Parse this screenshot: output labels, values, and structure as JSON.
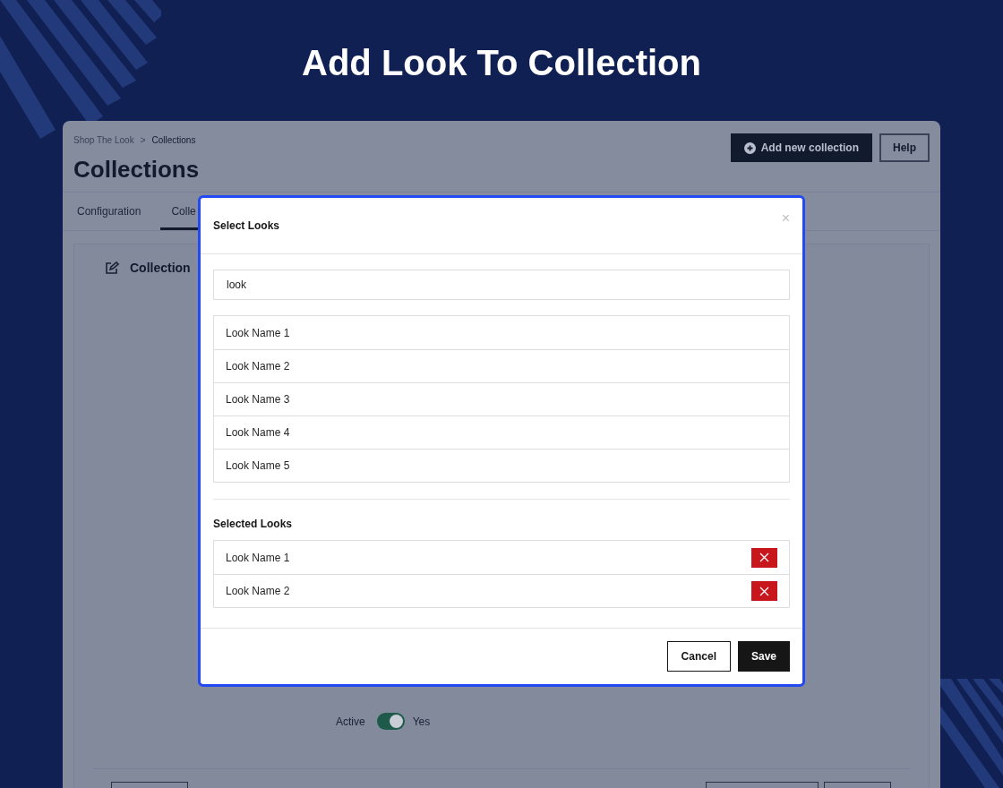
{
  "page_title": "Add Look To Collection",
  "app": {
    "breadcrumb": [
      {
        "label": "Shop The Look"
      },
      {
        "label": "Collections"
      }
    ],
    "breadcrumb_separator": ">",
    "heading": "Collections",
    "header_buttons": [
      {
        "label": "Add new collection",
        "kind": "primary"
      },
      {
        "label": "Help",
        "kind": "outline"
      }
    ],
    "tabs": [
      {
        "label": "Configuration",
        "selected": false
      },
      {
        "label": "Colle",
        "selected": true
      }
    ],
    "section_title": "Collection",
    "active_label": "Active",
    "active_toggle": {
      "on": true,
      "label": "Yes"
    }
  },
  "modal": {
    "title": "Select Looks",
    "close": "×",
    "search": {
      "value": "look"
    },
    "results": [
      {
        "label": "Look Name 1"
      },
      {
        "label": "Look Name 2"
      },
      {
        "label": "Look Name 3"
      },
      {
        "label": "Look Name 4"
      },
      {
        "label": "Look Name 5"
      }
    ],
    "selected_title": "Selected Looks",
    "selected": [
      {
        "label": "Look Name 1"
      },
      {
        "label": "Look Name 2"
      }
    ],
    "buttons": [
      {
        "label": "Cancel",
        "kind": "secondary"
      },
      {
        "label": "Save",
        "kind": "primary"
      }
    ]
  }
}
